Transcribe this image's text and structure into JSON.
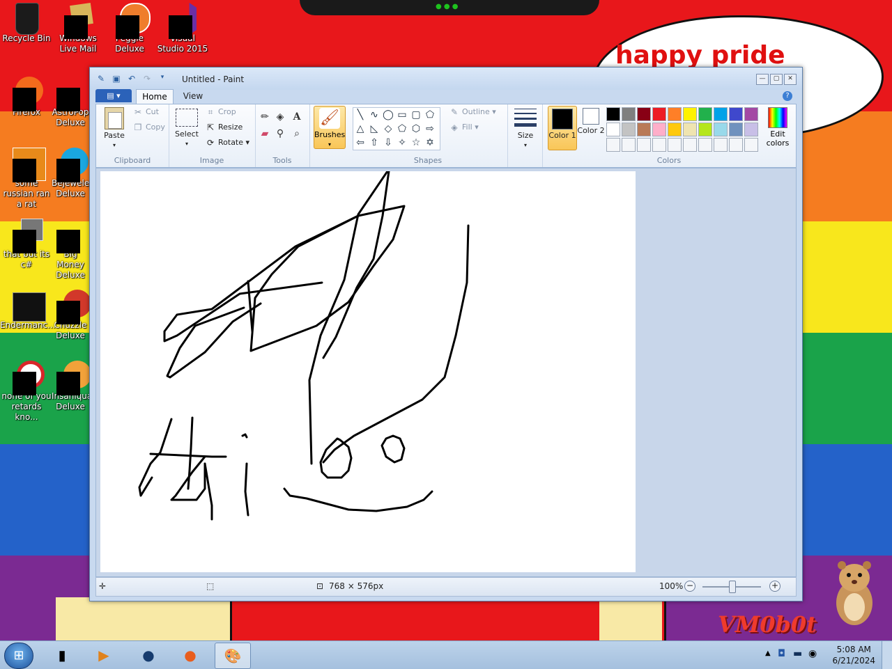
{
  "desktop": {
    "wallpaper_colors": [
      "#e8171b",
      "#f57c20",
      "#f8e71c",
      "#1aa34a",
      "#2462c9",
      "#7b2a92"
    ],
    "speech_bubble_text": "happy pride month",
    "logo_text": "VM0b0t",
    "icons": [
      {
        "label": "Recycle Bin",
        "glyph": "recycle-bin-icon"
      },
      {
        "label": "Windows Live Mail",
        "glyph": "mail-icon"
      },
      {
        "label": "Peggle Deluxe",
        "glyph": "peggle-icon"
      },
      {
        "label": "Visual Studio 2015",
        "glyph": "visual-studio-icon"
      },
      {
        "label": "Firefox",
        "glyph": "firefox-icon"
      },
      {
        "label": "AstroPop Deluxe",
        "glyph": "game-icon"
      },
      {
        "label": "some russian ran a rat",
        "glyph": "ie-icon"
      },
      {
        "label": "Bejeweled Deluxe",
        "glyph": "game-icon"
      },
      {
        "label": "that but its c#",
        "glyph": "copy-icon"
      },
      {
        "label": "Big Money Deluxe",
        "glyph": "game-icon"
      },
      {
        "label": "Endermanc...",
        "glyph": "window-icon"
      },
      {
        "label": "Chuzzle Deluxe",
        "glyph": "game-icon"
      },
      {
        "label": "none of you retards kno...",
        "glyph": "opera-icon"
      },
      {
        "label": "Insaniquarium Deluxe",
        "glyph": "game-icon"
      }
    ]
  },
  "paint": {
    "title": "Untitled - Paint",
    "tabs": {
      "file": "▤ ▾",
      "home": "Home",
      "view": "View"
    },
    "clipboard": {
      "paste": "Paste",
      "cut": "Cut",
      "copy": "Copy",
      "label": "Clipboard"
    },
    "image": {
      "select": "Select",
      "crop": "Crop",
      "resize": "Resize",
      "rotate": "Rotate",
      "label": "Image"
    },
    "tools": {
      "label": "Tools"
    },
    "brushes": {
      "label": "Brushes"
    },
    "shapes": {
      "outline": "Outline",
      "fill": "Fill",
      "label": "Shapes"
    },
    "size": {
      "label": "Size"
    },
    "colors": {
      "color1": "Color 1",
      "color2": "Color 2",
      "color1_value": "#000000",
      "color2_value": "#ffffff",
      "edit": "Edit colors",
      "label": "Colors",
      "palette": [
        "#000000",
        "#7f7f7f",
        "#880015",
        "#ed1c24",
        "#ff7f27",
        "#fff200",
        "#22b14c",
        "#00a2e8",
        "#3f48cc",
        "#a349a4",
        "#ffffff",
        "#c3c3c3",
        "#b97a57",
        "#ffaec9",
        "#ffc90e",
        "#efe4b0",
        "#b5e61d",
        "#99d9ea",
        "#7092be",
        "#c8bfe7"
      ]
    },
    "status": {
      "dimensions": "768 × 576px",
      "zoom": "100%"
    }
  },
  "taskbar": {
    "time": "5:08 AM",
    "date": "6/21/2024"
  }
}
